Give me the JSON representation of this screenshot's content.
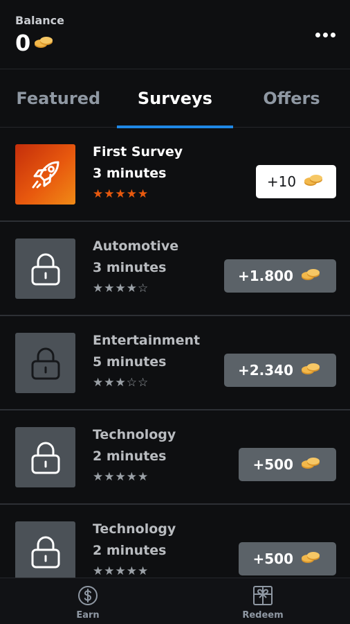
{
  "header": {
    "balance_label": "Balance",
    "balance_value": "0",
    "coin_icon": "coin-icon",
    "menu_icon": "more-horizontal-icon"
  },
  "tabs": [
    {
      "label": "Featured",
      "active": false
    },
    {
      "label": "Surveys",
      "active": true
    },
    {
      "label": "Offers",
      "active": false
    }
  ],
  "surveys": [
    {
      "title": "First Survey",
      "duration": "3 minutes",
      "rating": 5,
      "reward": "+10",
      "icon": "rocket-icon",
      "locked": false
    },
    {
      "title": "Automotive",
      "duration": "3 minutes",
      "rating": 4,
      "reward": "+1.800",
      "icon": "lock-icon",
      "locked": true
    },
    {
      "title": "Entertainment",
      "duration": "5 minutes",
      "rating": 3,
      "reward": "+2.340",
      "icon": "lock-icon",
      "locked": true
    },
    {
      "title": "Technology",
      "duration": "2 minutes",
      "rating": 5,
      "reward": "+500",
      "icon": "lock-icon",
      "locked": true
    },
    {
      "title": "Technology",
      "duration": "2 minutes",
      "rating": 5,
      "reward": "+500",
      "icon": "lock-icon",
      "locked": true
    }
  ],
  "bottom_nav": {
    "earn": {
      "label": "Earn",
      "icon": "dollar-circle-icon"
    },
    "redeem": {
      "label": "Redeem",
      "icon": "gift-icon"
    }
  },
  "colors": {
    "background": "#0e0f11",
    "active_tab_underline": "#1f88e5",
    "star_filled_featured": "#e8590e",
    "star_locked": "#9aa0a6",
    "coin": "#f2b84b"
  }
}
